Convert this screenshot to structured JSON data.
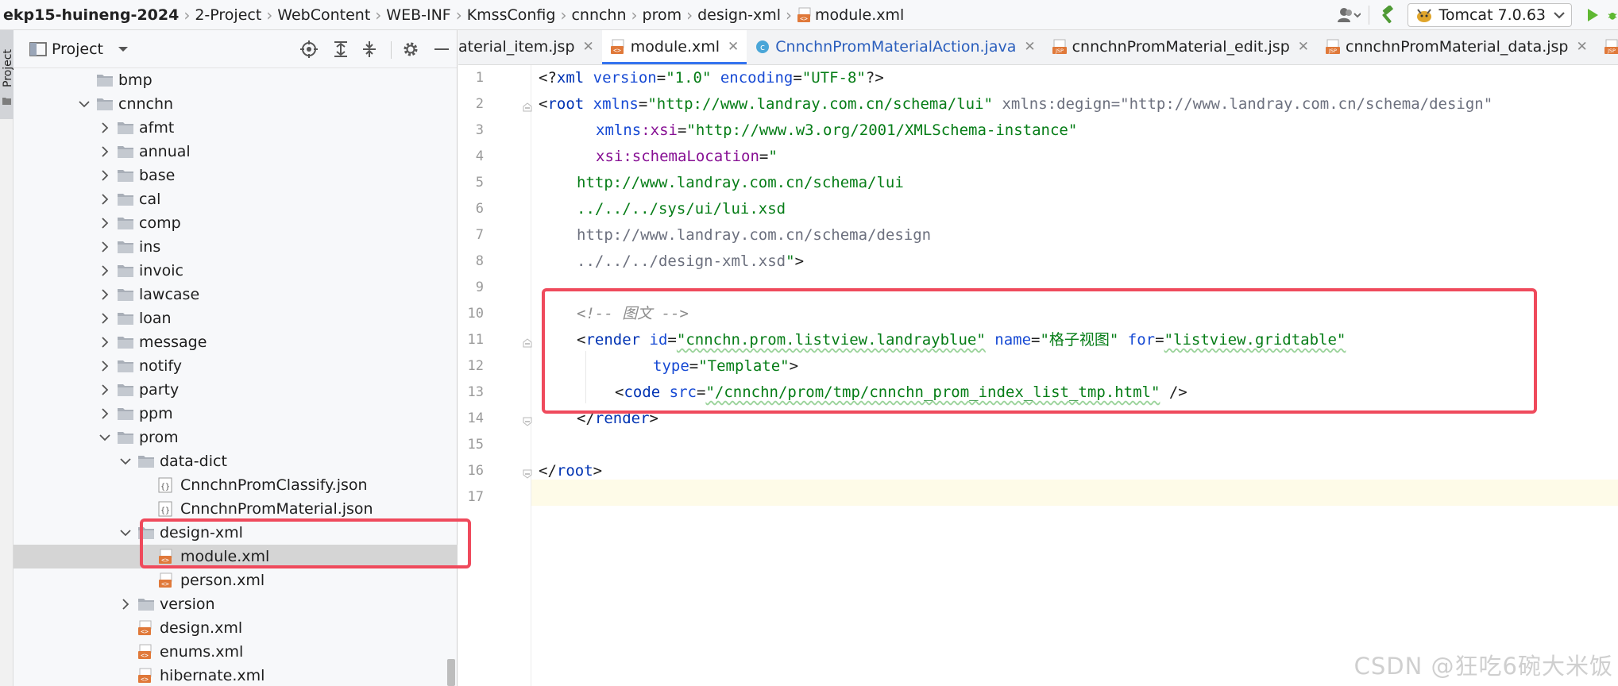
{
  "breadcrumb": [
    {
      "label": "ekp15-huineng-2024",
      "bold": true
    },
    {
      "label": "2-Project"
    },
    {
      "label": "WebContent"
    },
    {
      "label": "WEB-INF"
    },
    {
      "label": "KmssConfig"
    },
    {
      "label": "cnnchn"
    },
    {
      "label": "prom"
    },
    {
      "label": "design-xml"
    },
    {
      "label": "module.xml",
      "icon": "xml-file-icon"
    }
  ],
  "toolbar": {
    "run_config_label": "Tomcat 7.0.63"
  },
  "project_panel": {
    "title": "Project",
    "side_tab_label": "Project"
  },
  "tree": [
    {
      "label": "bmp",
      "type": "folder",
      "depth": 1,
      "expanded": null
    },
    {
      "label": "cnnchn",
      "type": "folder",
      "depth": 1,
      "expanded": true
    },
    {
      "label": "afmt",
      "type": "folder",
      "depth": 2,
      "expanded": false
    },
    {
      "label": "annual",
      "type": "folder",
      "depth": 2,
      "expanded": false
    },
    {
      "label": "base",
      "type": "folder",
      "depth": 2,
      "expanded": false
    },
    {
      "label": "cal",
      "type": "folder",
      "depth": 2,
      "expanded": false
    },
    {
      "label": "comp",
      "type": "folder",
      "depth": 2,
      "expanded": false
    },
    {
      "label": "ins",
      "type": "folder",
      "depth": 2,
      "expanded": false
    },
    {
      "label": "invoic",
      "type": "folder",
      "depth": 2,
      "expanded": false
    },
    {
      "label": "lawcase",
      "type": "folder",
      "depth": 2,
      "expanded": false
    },
    {
      "label": "loan",
      "type": "folder",
      "depth": 2,
      "expanded": false
    },
    {
      "label": "message",
      "type": "folder",
      "depth": 2,
      "expanded": false
    },
    {
      "label": "notify",
      "type": "folder",
      "depth": 2,
      "expanded": false
    },
    {
      "label": "party",
      "type": "folder",
      "depth": 2,
      "expanded": false
    },
    {
      "label": "ppm",
      "type": "folder",
      "depth": 2,
      "expanded": false
    },
    {
      "label": "prom",
      "type": "folder",
      "depth": 2,
      "expanded": true
    },
    {
      "label": "data-dict",
      "type": "folder",
      "depth": 3,
      "expanded": true
    },
    {
      "label": "CnnchnPromClassify.json",
      "type": "json",
      "depth": 4,
      "expanded": null
    },
    {
      "label": "CnnchnPromMaterial.json",
      "type": "json",
      "depth": 4,
      "expanded": null
    },
    {
      "label": "design-xml",
      "type": "folder",
      "depth": 3,
      "expanded": true
    },
    {
      "label": "module.xml",
      "type": "xml",
      "depth": 4,
      "expanded": null,
      "selected": true
    },
    {
      "label": "person.xml",
      "type": "xml",
      "depth": 4,
      "expanded": null
    },
    {
      "label": "version",
      "type": "folder",
      "depth": 3,
      "expanded": false
    },
    {
      "label": "design.xml",
      "type": "xml",
      "depth": 3,
      "expanded": null
    },
    {
      "label": "enums.xml",
      "type": "xml",
      "depth": 3,
      "expanded": null
    },
    {
      "label": "hibernate.xml",
      "type": "xml",
      "depth": 3,
      "expanded": null
    }
  ],
  "tabs": [
    {
      "label": "aterial_item.jsp",
      "icon": "none",
      "active": false,
      "closable": false
    },
    {
      "label": "module.xml",
      "icon": "xml",
      "active": true,
      "closable": true
    },
    {
      "label": "CnnchnPromMaterialAction.java",
      "icon": "class",
      "active": false,
      "closable": true
    },
    {
      "label": "cnnchnPromMaterial_edit.jsp",
      "icon": "jsp",
      "active": false,
      "closable": true
    },
    {
      "label": "cnnchnPromMaterial_data.jsp",
      "icon": "jsp",
      "active": false,
      "closable": true
    },
    {
      "label": "cnnchnP",
      "icon": "jsp",
      "active": false,
      "closable": false
    }
  ],
  "line_numbers": [
    "1",
    "2",
    "3",
    "4",
    "5",
    "6",
    "7",
    "8",
    "9",
    "10",
    "11",
    "12",
    "13",
    "14",
    "15",
    "16",
    "17"
  ],
  "code": {
    "l1": {
      "a": "<?",
      "b": "xml",
      "c": " version",
      "d": "=",
      "e": "\"1.0\"",
      "f": " encoding",
      "g": "=",
      "h": "\"UTF-8\"",
      "i": "?>"
    },
    "l2": {
      "a": "<",
      "b": "root",
      "c": " xmlns",
      "d": "=",
      "e": "\"http://www.landray.com.cn/schema/lui\"",
      "f": " xmlns:degign=\"http://www.landray.com.cn/schema/design\""
    },
    "l3": {
      "a": "xmlns",
      "b": ":xsi",
      "c": "=",
      "d": "\"http://www.w3.org/2001/XMLSchema-instance\""
    },
    "l4": {
      "a": "xsi",
      "b": ":schemaLocation",
      "c": "=",
      "d": "\""
    },
    "l5": "http://www.landray.com.cn/schema/lui",
    "l6": "../../../sys/ui/lui.xsd",
    "l7": "http://www.landray.com.cn/schema/design",
    "l8": {
      "a": "../../../design-xml.xsd",
      "b": "\"",
      "c": ">"
    },
    "l10": "<!-- 图文 -->",
    "l11": {
      "a": "<",
      "b": "render",
      "c": " id",
      "d": "=",
      "e": "\"cnnchn.prom.listview.landrayblue\"",
      "f": " name",
      "g": "=",
      "h": "\"格子视图\"",
      "i": " for",
      "j": "=",
      "k": "\"listview.gridtable\""
    },
    "l12": {
      "a": "type",
      "b": "=",
      "c": "\"Template\"",
      "d": ">"
    },
    "l13": {
      "a": "<",
      "b": "code",
      "c": " src",
      "d": "=",
      "e": "\"/cnnchn/prom/tmp/cnnchn_prom_index_list_tmp.html\"",
      "f": " />"
    },
    "l14": {
      "a": "</",
      "b": "render",
      "c": ">"
    },
    "l16": {
      "a": "</",
      "b": "root",
      "c": ">"
    }
  },
  "watermark": "CSDN @狂吃6碗大米饭",
  "colors": {
    "highlight_box": "#ef4a5c",
    "tab_active_underline": "#3574f0",
    "tag": "#0033b3",
    "string": "#067d17",
    "namespace": "#871094"
  }
}
